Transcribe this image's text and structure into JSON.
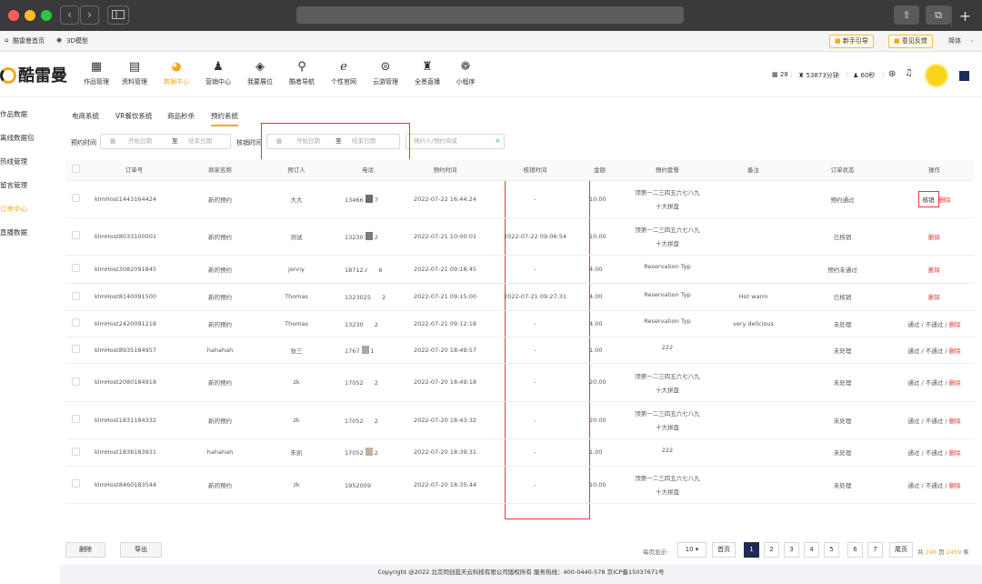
{
  "browser": {
    "url": "",
    "nav_back": "‹",
    "nav_forward": "›"
  },
  "topbar": {
    "home_link": "酷雷曼首页",
    "model_link": "3D模型",
    "guide_btn": "新手引导",
    "feedback_btn": "意见反馈",
    "lang": "简体"
  },
  "header": {
    "logo_text": "酷雷曼",
    "nav": [
      {
        "label": "作品管理",
        "icon": "grid-icon"
      },
      {
        "label": "资料管理",
        "icon": "document-icon"
      },
      {
        "label": "数据中心",
        "icon": "pie-chart-icon"
      },
      {
        "label": "营销中心",
        "icon": "person-icon"
      },
      {
        "label": "我要展位",
        "icon": "box-icon"
      },
      {
        "label": "酷者导航",
        "icon": "location-pin-icon"
      },
      {
        "label": "个性官网",
        "icon": "browser-icon"
      },
      {
        "label": "云游管理",
        "icon": "vr-headset-icon"
      },
      {
        "label": "全景直播",
        "icon": "live-broadcast-icon"
      },
      {
        "label": "小程序",
        "icon": "miniprogram-icon"
      }
    ],
    "stat_works": "28",
    "stat_minutes": "53873分钟",
    "stat_seconds": "60秒"
  },
  "sidebar": {
    "items": [
      "作品数据",
      "离线数据包",
      "热线管理",
      "留言管理",
      "订单中心",
      "直播数据"
    ]
  },
  "tabs": [
    "电商系统",
    "VR餐饮系统",
    "商品秒杀",
    "预约系统"
  ],
  "filters": {
    "booking_time_label": "预约时间",
    "verify_time_label": "核销时间",
    "start_placeholder": "开始日期",
    "to": "至",
    "end_placeholder": "结束日期",
    "search_placeholder": "预约人/预约商或"
  },
  "table": {
    "headers": [
      "",
      "订单号",
      "商家名称",
      "预订人",
      "电话",
      "预约时间",
      "核销时间",
      "金额",
      "预约套餐",
      "备注",
      "订单状态",
      "操作"
    ],
    "rows": [
      {
        "order": "klmHost1443164424",
        "merchant": "新的预约",
        "booker": "大大",
        "phone_a": "13466",
        "phone_b": "7",
        "pcolor": "#6b6b78",
        "time": "2022-07-22 16:44:24",
        "verify": "-",
        "amount": "10.00",
        "pkg1": "顶第一二三四五六七八九",
        "pkg2": "十大拼盘",
        "note": "",
        "status": "预约通过",
        "status_color": "green",
        "op": "verify"
      },
      {
        "order": "klmHost8033100001",
        "merchant": "新的预约",
        "booker": "测试",
        "phone_a": "13230",
        "phone_b": "2",
        "pcolor": "#7b7b7b",
        "time": "2022-07-21 10:00:01",
        "verify": "2022-07-22 09:06:54",
        "amount": "10.00",
        "pkg1": "顶第一二三四五六七八九",
        "pkg2": "十大拼盘",
        "note": "",
        "status": "已核销",
        "status_color": "green",
        "op": "delete"
      },
      {
        "order": "klmHost3082091845",
        "merchant": "新的预约",
        "booker": "jenny",
        "phone_a": "18712.r",
        "phone_b": "6",
        "pcolor": "",
        "time": "2022-07-21 09:18:45",
        "verify": "-",
        "amount": "4.00",
        "pkg1": "Reservation Typ",
        "pkg2": "",
        "note": "",
        "status": "预约未通过",
        "status_color": "red",
        "op": "delete"
      },
      {
        "order": "klmHost8140091500",
        "merchant": "新的预约",
        "booker": "Thomas",
        "phone_a": "1323025",
        "phone_b": "2",
        "pcolor": "",
        "time": "2022-07-21 09:15:00",
        "verify": "2022-07-21 09:27:31",
        "amount": "4.00",
        "pkg1": "Reservation Typ",
        "pkg2": "",
        "note": "Hot warm",
        "status": "已核销",
        "status_color": "green",
        "op": "delete"
      },
      {
        "order": "klmHost2420091218",
        "merchant": "新的预约",
        "booker": "Thomas",
        "phone_a": "13230",
        "phone_b": "2",
        "pcolor": "",
        "time": "2022-07-21 09:12:18",
        "verify": "-",
        "amount": "4.00",
        "pkg1": "Reservation Typ",
        "pkg2": "",
        "note": "very delicious",
        "status": "未处理",
        "status_color": "orange",
        "op": "pending"
      },
      {
        "order": "klmHost8935184957",
        "merchant": "hahahah",
        "booker": "张三",
        "phone_a": "1767",
        "phone_b": "1",
        "pcolor": "#b0a49c",
        "time": "2022-07-20 18:49:57",
        "verify": "-",
        "amount": "1.00",
        "pkg1": "222",
        "pkg2": "",
        "note": "",
        "status": "未处理",
        "status_color": "orange",
        "op": "pending"
      },
      {
        "order": "klmHost2080184918",
        "merchant": "新的预约",
        "booker": "zk",
        "phone_a": "17052",
        "phone_b": "2",
        "pcolor": "",
        "time": "2022-07-20 18:49:18",
        "verify": "-",
        "amount": "20.00",
        "pkg1": "顶第一二三四五六七八九",
        "pkg2": "十大拼盘",
        "note": "",
        "status": "未处理",
        "status_color": "orange",
        "op": "pending"
      },
      {
        "order": "klmHost1831184332",
        "merchant": "新的预约",
        "booker": "zk",
        "phone_a": "17052",
        "phone_b": "2",
        "pcolor": "",
        "time": "2022-07-20 18:43:32",
        "verify": "-",
        "amount": "20.00",
        "pkg1": "顶第一二三四五六七八九",
        "pkg2": "十大拼盘",
        "note": "",
        "status": "未处理",
        "status_color": "orange",
        "op": "pending"
      },
      {
        "order": "klmHost1838183931",
        "merchant": "hahahah",
        "booker": "朱凯",
        "phone_a": "17052",
        "phone_b": "2",
        "pcolor": "#c9ae98",
        "time": "2022-07-20 18:39:31",
        "verify": "-",
        "amount": "1.00",
        "pkg1": "222",
        "pkg2": "",
        "note": "",
        "status": "未处理",
        "status_color": "orange",
        "op": "pending"
      },
      {
        "order": "klmHost8460183544",
        "merchant": "新的预约",
        "booker": "zk",
        "phone_a": "1952009",
        "phone_b": "",
        "pcolor": "",
        "time": "2022-07-20 18:35:44",
        "verify": "-",
        "amount": "10.00",
        "pkg1": "顶第一二三四五六七八九",
        "pkg2": "十大拼盘",
        "note": "",
        "status": "未处理",
        "status_color": "orange",
        "op": "pending"
      }
    ],
    "op_labels": {
      "verify": "核销",
      "delete": "删除",
      "pass": "通过",
      "reject": "不通过",
      "sep": " / "
    }
  },
  "actions": {
    "delete": "删除",
    "export": "导出"
  },
  "pagination": {
    "per_page_label": "每页显示:",
    "per_page": "10 ▾",
    "first": "首页",
    "pages": [
      "1",
      "2",
      "3",
      "4",
      "5",
      "6",
      "7"
    ],
    "current": "1",
    "last": "尾页",
    "total_a": "共",
    "total_pages": "246",
    "total_b": "页",
    "total_items": "2459",
    "total_c": "条"
  },
  "footer": "Copyright @2022 北京同创蓝天云科技有限公司版权所有 服务热线：400-0440-578 京ICP备15037671号",
  "colors": {
    "accent": "#f5a623",
    "active_page": "#1f2a55",
    "annotation_red": "#e53935"
  }
}
